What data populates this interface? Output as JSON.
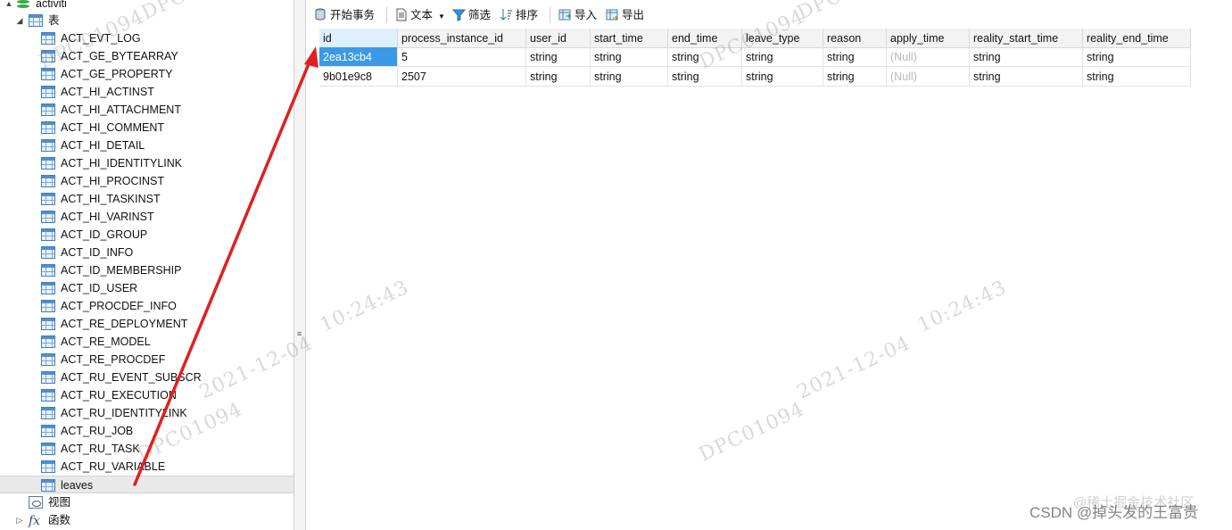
{
  "tree": {
    "db_name": "activiti",
    "tables_group": "表",
    "tables": [
      "ACT_EVT_LOG",
      "ACT_GE_BYTEARRAY",
      "ACT_GE_PROPERTY",
      "ACT_HI_ACTINST",
      "ACT_HI_ATTACHMENT",
      "ACT_HI_COMMENT",
      "ACT_HI_DETAIL",
      "ACT_HI_IDENTITYLINK",
      "ACT_HI_PROCINST",
      "ACT_HI_TASKINST",
      "ACT_HI_VARINST",
      "ACT_ID_GROUP",
      "ACT_ID_INFO",
      "ACT_ID_MEMBERSHIP",
      "ACT_ID_USER",
      "ACT_PROCDEF_INFO",
      "ACT_RE_DEPLOYMENT",
      "ACT_RE_MODEL",
      "ACT_RE_PROCDEF",
      "ACT_RU_EVENT_SUBSCR",
      "ACT_RU_EXECUTION",
      "ACT_RU_IDENTITYLINK",
      "ACT_RU_JOB",
      "ACT_RU_TASK",
      "ACT_RU_VARIABLE",
      "leaves"
    ],
    "selected_table": "leaves",
    "views_group": "视图",
    "functions_group": "函数"
  },
  "toolbar": {
    "begin_transaction": "开始事务",
    "text": "文本",
    "filter": "筛选",
    "sort": "排序",
    "import": "导入",
    "export": "导出"
  },
  "grid": {
    "columns": [
      "id",
      "process_instance_id",
      "user_id",
      "start_time",
      "end_time",
      "leave_type",
      "reason",
      "apply_time",
      "reality_start_time",
      "reality_end_time"
    ],
    "rows": [
      [
        "2ea13cb4",
        "5",
        "string",
        "string",
        "string",
        "string",
        "string",
        "(Null)",
        "string",
        "string"
      ],
      [
        "9b01e9c8",
        "2507",
        "string",
        "string",
        "string",
        "string",
        "string",
        "(Null)",
        "string",
        "string"
      ]
    ]
  },
  "watermark": {
    "id_text": "DPC01094",
    "date_text": "2021-12-04",
    "time_text": "10:24:43"
  },
  "branding": {
    "csdn": "CSDN @掉头发的王富贵",
    "juejin": "@稀土掘金技术社区"
  },
  "colors": {
    "selection": "#3b9ae8",
    "arrow": "#e02020",
    "db_icon": "#3aa845"
  }
}
